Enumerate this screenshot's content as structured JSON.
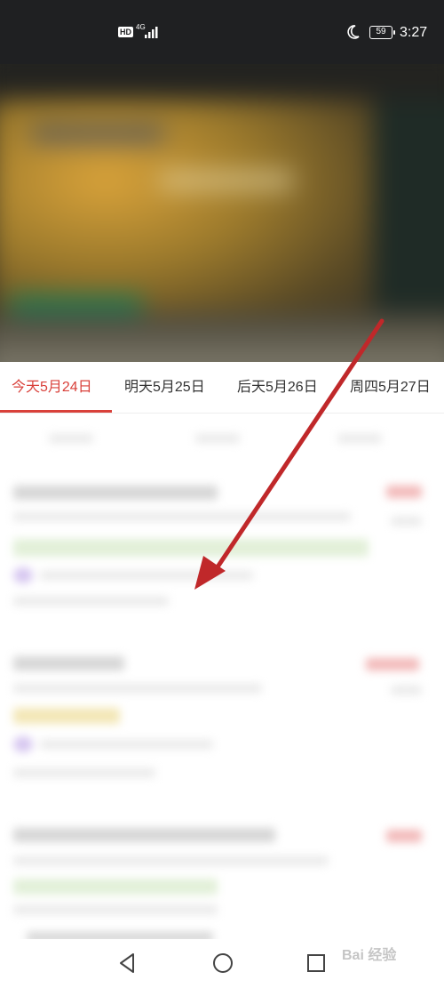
{
  "status_bar": {
    "hd": "HD",
    "network": "4G",
    "battery": "59",
    "time": "3:27"
  },
  "tabs": [
    {
      "label": "今天5月24日",
      "active": true
    },
    {
      "label": "明天5月25日",
      "active": false
    },
    {
      "label": "后天5月26日",
      "active": false
    },
    {
      "label": "周四5月27日",
      "active": false
    }
  ],
  "accent_color": "#d9403a",
  "annotation_color": "#c0282a",
  "watermark": "Bai 经验"
}
